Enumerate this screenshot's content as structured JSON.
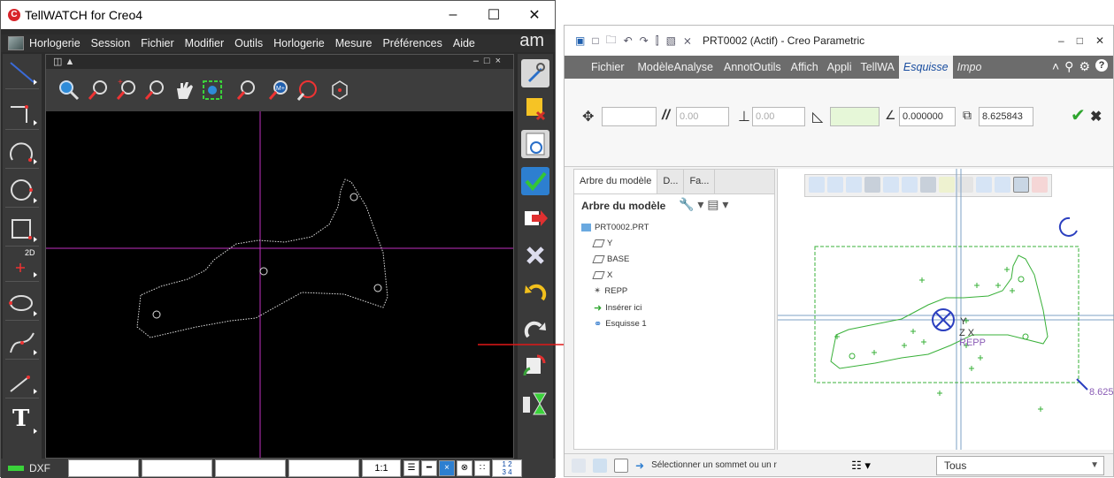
{
  "tellwatch": {
    "title": "TellWATCH for Creo4",
    "window_controls": {
      "minimize": "–",
      "maximize": "☐",
      "close": "✕"
    },
    "menu": [
      "Horlogerie",
      "Session",
      "Fichier",
      "Modifier",
      "Outils",
      "Horlogerie",
      "Mesure",
      "Préférences",
      "Aide"
    ],
    "brand": "am",
    "left_tools": [
      "line-tool",
      "polyline-tool",
      "arc-tool",
      "circle-tool",
      "rectangle-tool",
      "point-tool",
      "ellipse-tool",
      "spline-tool",
      "dimension-tool",
      "text-tool"
    ],
    "point_tool_label": "2D",
    "text_tool_label": "T",
    "view_toolbar": [
      "zoom-icon",
      "zoom-in-icon",
      "zoom-out-icon",
      "pan-hand-icon",
      "zoom-fit-icon",
      "zoom-window-icon",
      "zoom-memory-icon",
      "zoom-previous-icon",
      "3d-view-icon"
    ],
    "right_tools": [
      "tools-icon",
      "delete-layer-icon",
      "refresh-icon",
      "validate-check-icon",
      "export-icon",
      "cancel-x-icon",
      "undo-icon",
      "redo-icon",
      "transfer-icon",
      "hourglass-icon"
    ],
    "status": {
      "format": "DXF",
      "scale": "1:1",
      "fraction_top": "1  2",
      "fraction_bottom": "3  4",
      "close_glyph": "×",
      "snap_glyph": "⊗",
      "grid_glyph": "∷"
    }
  },
  "creo": {
    "title": "PRT0002 (Actif) - Creo Parametric",
    "quick_access": [
      "▣",
      "□",
      "🗀",
      "↶",
      "↷",
      "⫿",
      "▧",
      "⨯"
    ],
    "window_controls": {
      "minimize": "–",
      "maximize": "□",
      "close": "✕"
    },
    "ribbon_tabs": [
      "Fichier",
      "Modèle",
      "Analyse",
      "Annot",
      "Outils",
      "Affich",
      "Appli",
      "TellWA",
      "Esquisse",
      "Impo"
    ],
    "dashboard": {
      "field1": "",
      "field2": "0.00",
      "field3": "0.00",
      "field4": "",
      "angle_value": "0.000000",
      "scale_value": "8.625843"
    },
    "tree": {
      "tabs": [
        "Arbre du modèle",
        "D...",
        "Fa..."
      ],
      "heading": "Arbre du modèle",
      "nodes": [
        "PRT0002.PRT",
        "Y",
        "BASE",
        "X",
        "REPP",
        "Insérer ici",
        "Esquisse 1"
      ]
    },
    "canvas": {
      "labels": {
        "y": "Y",
        "zx": "Z X",
        "repp": "REPP",
        "dimension": "8.625"
      }
    },
    "status": {
      "message": "Sélectionner un sommet ou un r",
      "filter": "Tous"
    }
  }
}
